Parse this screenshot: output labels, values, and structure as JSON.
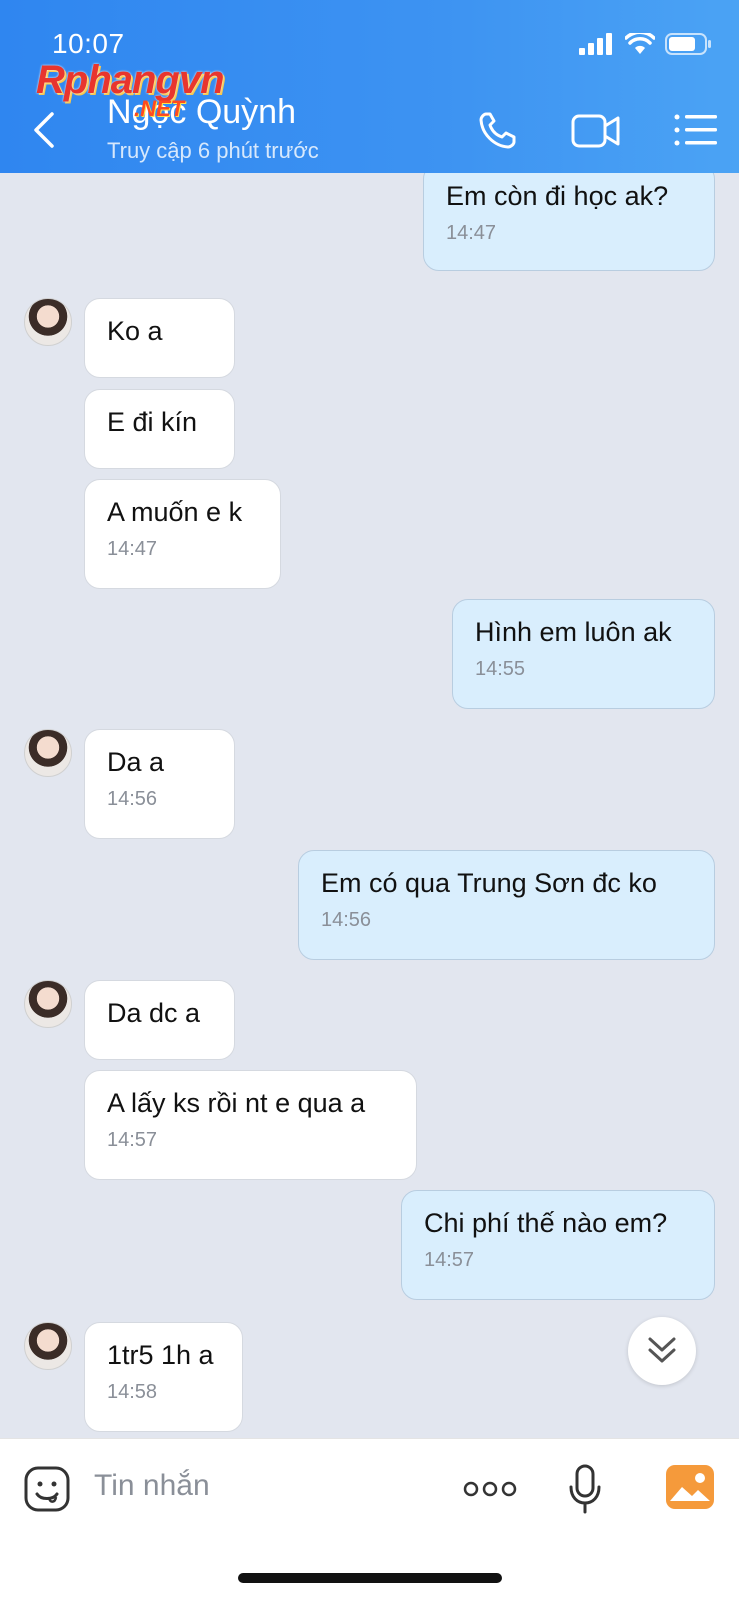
{
  "status_bar": {
    "time": "10:07"
  },
  "watermark": {
    "main": "Rphangvn",
    "suffix": ".NET"
  },
  "header": {
    "contact_name": "Ngọc Quỳnh",
    "contact_status": "Truy cập 6 phút trước"
  },
  "messages": [
    {
      "direction": "out",
      "text": "Em còn đi học ak?",
      "time": "14:47"
    },
    {
      "direction": "in",
      "text": "Ko a",
      "time": ""
    },
    {
      "direction": "in",
      "text": "E đi kín",
      "time": ""
    },
    {
      "direction": "in",
      "text": "A muốn e k",
      "time": "14:47"
    },
    {
      "direction": "out",
      "text": "Hình em luôn ak",
      "time": "14:55"
    },
    {
      "direction": "in",
      "text": "Da a",
      "time": "14:56"
    },
    {
      "direction": "out",
      "text": "Em có qua Trung Sơn đc ko",
      "time": "14:56"
    },
    {
      "direction": "in",
      "text": "Da dc a",
      "time": ""
    },
    {
      "direction": "in",
      "text": "A lấy ks rồi nt e qua a",
      "time": "14:57"
    },
    {
      "direction": "out",
      "text": "Chi phí thế nào em?",
      "time": "14:57"
    },
    {
      "direction": "in",
      "text": "1tr5 1h a",
      "time": "14:58"
    }
  ],
  "composer": {
    "placeholder": "Tin nhắn"
  },
  "colors": {
    "header_blue": "#3b8ff1",
    "outgoing_bubble": "#d9eefd",
    "incoming_bubble": "#ffffff",
    "chat_background": "#e2e6ef"
  }
}
